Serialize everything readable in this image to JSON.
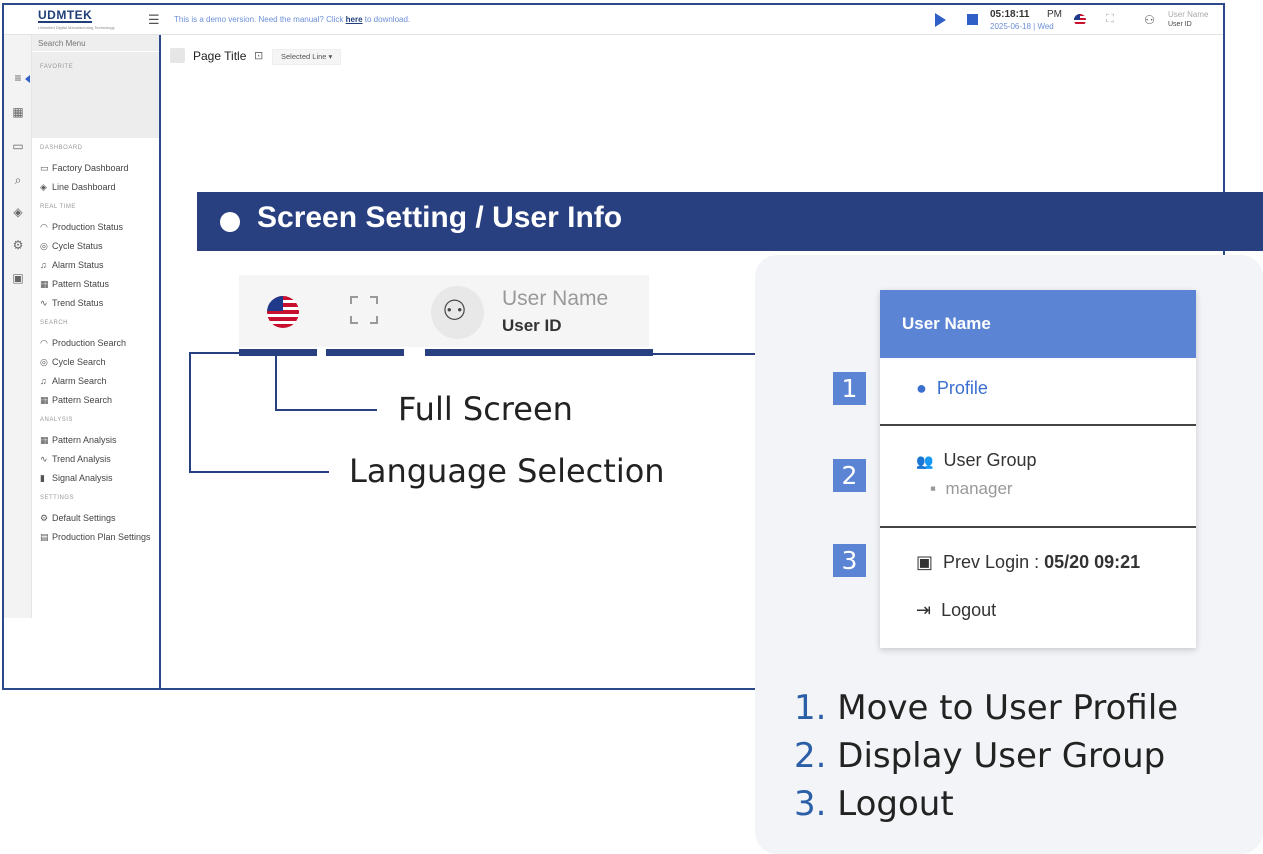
{
  "app": {
    "logo": "UDMTEK",
    "logo_sub": "Unlimited Digital Manufacturing Technology",
    "demo_prefix": "This is a demo version. Need the manual? Click ",
    "demo_link": "here",
    "demo_suffix": " to download.",
    "time": "05:18:11",
    "ampm": "PM",
    "date": "2025-06-18 | Wed",
    "user_name": "User Name",
    "user_id": "User ID"
  },
  "menu": {
    "search_placeholder": "Search Menu",
    "favorite": "FAVORITE",
    "sections": [
      {
        "title": "DASHBOARD",
        "items": [
          {
            "icon": "monitor-icon",
            "label": "Factory Dashboard"
          },
          {
            "icon": "cube-icon",
            "label": "Line Dashboard"
          }
        ]
      },
      {
        "title": "REAL TIME",
        "items": [
          {
            "icon": "gauge-icon",
            "label": "Production Status"
          },
          {
            "icon": "target-icon",
            "label": "Cycle Status"
          },
          {
            "icon": "bell-icon",
            "label": "Alarm Status"
          },
          {
            "icon": "grid-icon",
            "label": "Pattern Status"
          },
          {
            "icon": "trend-icon",
            "label": "Trend Status"
          }
        ]
      },
      {
        "title": "SEARCH",
        "items": [
          {
            "icon": "gauge-icon",
            "label": "Production Search"
          },
          {
            "icon": "target-icon",
            "label": "Cycle Search"
          },
          {
            "icon": "bell-icon",
            "label": "Alarm Search"
          },
          {
            "icon": "grid-icon",
            "label": "Pattern Search"
          }
        ]
      },
      {
        "title": "ANALYSIS",
        "items": [
          {
            "icon": "grid-icon",
            "label": "Pattern Analysis"
          },
          {
            "icon": "trend-icon",
            "label": "Trend Analysis"
          },
          {
            "icon": "bars-icon",
            "label": "Signal Analysis"
          }
        ]
      },
      {
        "title": "SETTINGS",
        "items": [
          {
            "icon": "gear-icon",
            "label": "Default Settings"
          },
          {
            "icon": "calendar-icon",
            "label": "Production Plan Settings"
          }
        ]
      }
    ]
  },
  "content": {
    "page_title": "Page Title",
    "selected_line": "Selected Line"
  },
  "overlay": {
    "banner_title": "Screen Setting / User Info",
    "zoom_user_name": "User Name",
    "zoom_user_id": "User ID",
    "label_fullscreen": "Full Screen",
    "label_language": "Language Selection"
  },
  "user_menu": {
    "header": "User Name",
    "profile": "Profile",
    "user_group": "User Group",
    "group_value": "manager",
    "prev_login_label": "Prev Login : ",
    "prev_login_value": "05/20 09:21",
    "logout": "Logout",
    "badges": [
      "1",
      "2",
      "3"
    ]
  },
  "descriptions": [
    {
      "num": "1.",
      "text": " Move to User Profile"
    },
    {
      "num": "2.",
      "text": " Display User Group"
    },
    {
      "num": "3.",
      "text": " Logout"
    }
  ],
  "colors": {
    "banner": "#283f80",
    "accent": "#5b85d4",
    "link": "#2f5fc7"
  }
}
